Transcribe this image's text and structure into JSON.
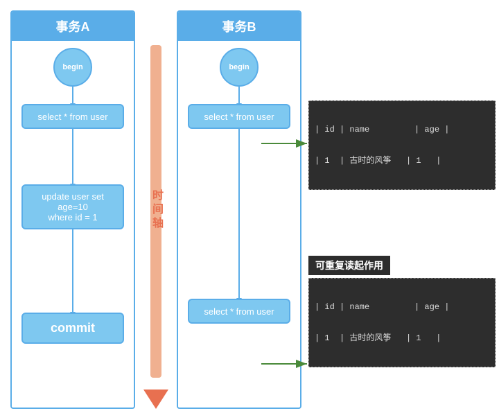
{
  "txA": {
    "title": "事务A",
    "begin": "begin",
    "sql1": "select * from user",
    "update": "update user set age=10\nwhere id = 1",
    "commit": "commit"
  },
  "txB": {
    "title": "事务B",
    "begin": "begin",
    "sql1": "select * from user",
    "sql2": "select * from user"
  },
  "timeAxis": {
    "label": "时间轴"
  },
  "table1": {
    "header": "| id | name         | age |",
    "row": "| 1  | 古时的风筝   | 1   |"
  },
  "table2": {
    "header": "| id | name         | age |",
    "row": "| 1  | 古时的风筝   | 1   |"
  },
  "repeatableReadLabel": "可重复读起作用"
}
